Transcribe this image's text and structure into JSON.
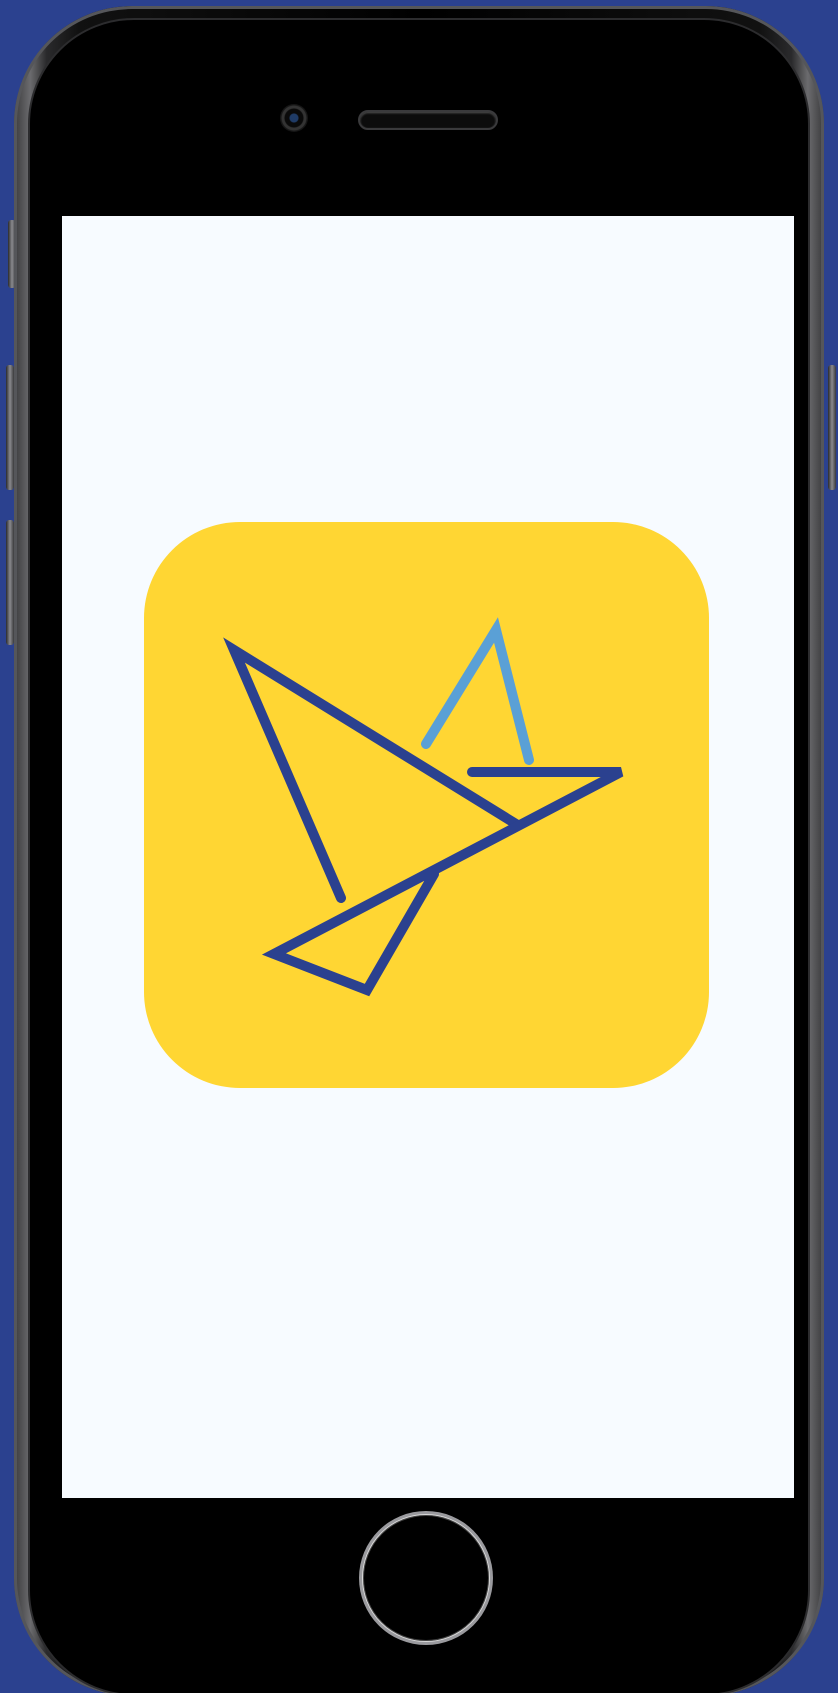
{
  "device": {
    "type": "phone-mockup",
    "body_color": "#000000",
    "background_color": "#2b418f"
  },
  "screen": {
    "background_color": "#f7fbff",
    "content": "app-splash"
  },
  "app_icon": {
    "background_color": "#ffd633",
    "mark": "origami-bird-logo-icon",
    "stroke_dark": "#2b418f",
    "stroke_light": "#5aa0d6"
  },
  "home_button": {
    "icon": "home-button-ring-icon"
  }
}
